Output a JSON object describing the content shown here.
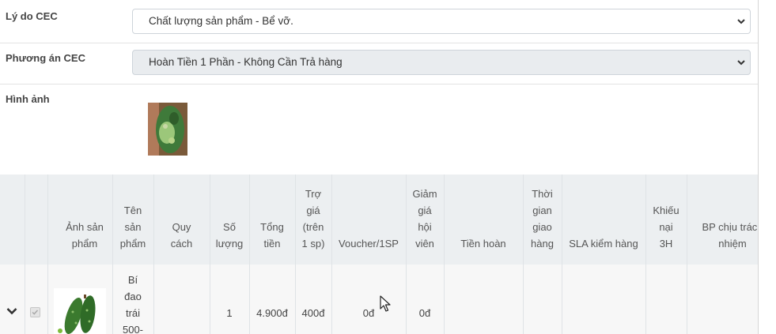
{
  "form": {
    "reason_label": "Lý do CEC",
    "reason_value": "Chất lượng sản phẩm - Bể vỡ.",
    "plan_label": "Phương án CEC",
    "plan_value": "Hoàn Tiền 1 Phần - Không Cần Trả hàng",
    "image_label": "Hình ảnh"
  },
  "table": {
    "headers": {
      "product_image": [
        "Ảnh sản",
        "phẩm"
      ],
      "product_name": [
        "Tên",
        "sản",
        "phẩm"
      ],
      "spec": [
        "Quy",
        "cách"
      ],
      "quantity": [
        "Số",
        "lượng"
      ],
      "total": [
        "Tổng",
        "tiền"
      ],
      "subsidy": [
        "Trợ",
        "giá",
        "(trên",
        "1 sp)"
      ],
      "voucher": [
        "Voucher/1SP"
      ],
      "member_discount": [
        "Giảm",
        "giá",
        "hội",
        "viên"
      ],
      "refund": [
        "Tiền hoàn"
      ],
      "delivery_time": [
        "Thời",
        "gian",
        "giao",
        "hàng"
      ],
      "sla": [
        "SLA kiểm hàng"
      ],
      "complaint": [
        "Khiếu",
        "nại",
        "3H"
      ],
      "responsible": [
        "BP chịu trách",
        "nhiệm"
      ]
    },
    "rows": [
      {
        "product_name": [
          "Bí",
          "đao",
          "trái",
          "500-"
        ],
        "quantity": "1",
        "total": "4.900đ",
        "subsidy": "400đ",
        "voucher": "0đ",
        "member_discount": "0đ"
      }
    ]
  },
  "colors": {
    "header_bg": "#eceff1",
    "row_bg": "#f7f7f7",
    "select_disabled_bg": "#e9ecef",
    "border": "#ced4da"
  }
}
